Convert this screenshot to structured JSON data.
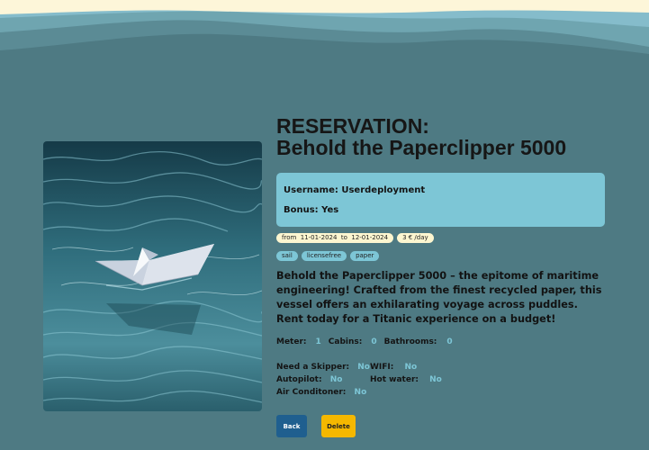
{
  "title_line1": "RESERVATION:",
  "title_line2": "Behold the Paperclipper 5000",
  "username_label": "Username:",
  "username": "Userdeployment",
  "bonus_label": "Bonus:",
  "bonus": "Yes",
  "date_range": {
    "from_label": "from",
    "from": "11-01-2024",
    "to_label": "to",
    "to": "12-01-2024"
  },
  "price": "3 € /day",
  "tags": [
    "sail",
    "licensefree",
    "paper"
  ],
  "description": "Behold the Paperclipper 5000 – the epitome of maritime engineering! Crafted from the finest recycled paper, this vessel offers an exhilarating voyage across puddles. Rent today for a Titanic experience on a budget!",
  "stats": {
    "meter_label": "Meter:",
    "meter": "1",
    "cabins_label": "Cabins:",
    "cabins": "0",
    "bathrooms_label": "Bathrooms:",
    "bathrooms": "0"
  },
  "features": {
    "skipper_label": "Need a Skipper:",
    "skipper": "No",
    "wifi_label": "WIFI:",
    "wifi": "No",
    "autopilot_label": "Autopilot:",
    "autopilot": "No",
    "hotwater_label": "Hot water:",
    "hotwater": "No",
    "ac_label": "Air Conditoner:",
    "ac": "No"
  },
  "buttons": {
    "back": "Back",
    "delete": "Delete"
  },
  "colors": {
    "background": "#4e7a83",
    "accent": "#7dc6d6",
    "back_button": "#1f5f8f",
    "delete_button": "#f5b800",
    "pill": "#fdf6d0"
  },
  "image": {
    "subject": "paper-boat-on-water"
  }
}
